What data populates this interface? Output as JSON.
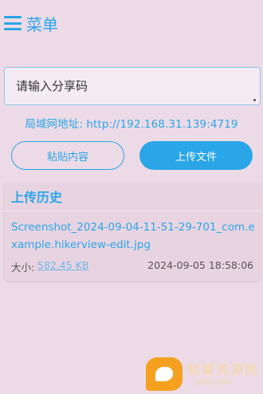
{
  "header": {
    "menu_label": "菜单"
  },
  "share_input": {
    "placeholder": "请输入分享码"
  },
  "lan_address": "局域网地址: http://192.168.31.139:4719",
  "buttons": {
    "paste": "粘贴内容",
    "upload": "上传文件"
  },
  "history": {
    "title": "上传历史",
    "items": [
      {
        "file_name": "Screenshot_2024-09-04-11-51-29-701_com.example.hikerview-edit.jpg",
        "size_label": "大小:",
        "size": "582.45 KB",
        "time": "2024-09-05 18:58:06"
      }
    ]
  },
  "watermark": {
    "text": "鲸翼资源网",
    "sub": "jyfzt.com"
  },
  "colors": {
    "accent": "#2aa6e8",
    "background": "#ecdbe6"
  }
}
